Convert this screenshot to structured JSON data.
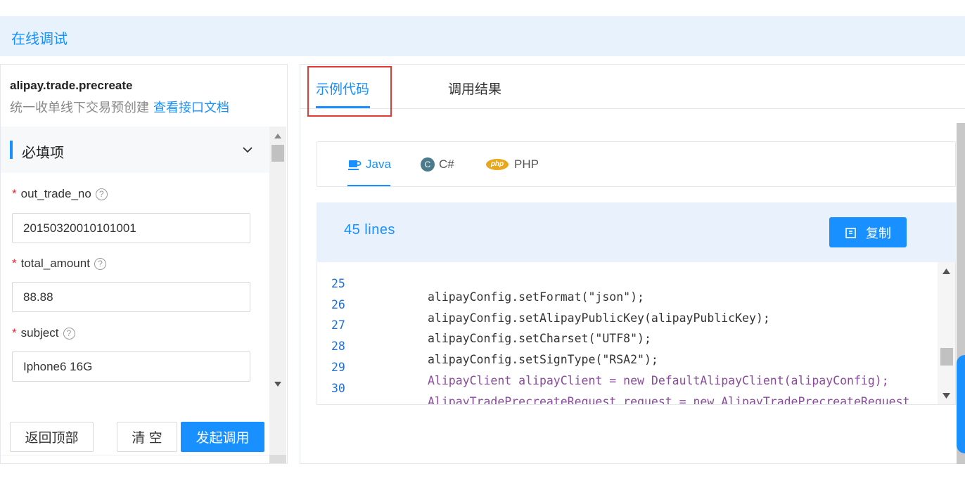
{
  "header": {
    "title": "在线调试"
  },
  "api": {
    "name": "alipay.trade.precreate",
    "description": "统一收单线下交易预创建",
    "doc_link": "查看接口文档"
  },
  "section": {
    "title": "必填项"
  },
  "fields": [
    {
      "name": "out_trade_no",
      "value": "20150320010101001",
      "required": "*",
      "help": "?"
    },
    {
      "name": "total_amount",
      "value": "88.88",
      "required": "*",
      "help": "?"
    },
    {
      "name": "subject",
      "value": "Iphone6 16G",
      "required": "*",
      "help": "?"
    }
  ],
  "buttons": {
    "back_top": "返回顶部",
    "clear": "清 空",
    "invoke": "发起调用"
  },
  "tabs": [
    {
      "label": "示例代码",
      "active": true
    },
    {
      "label": "调用结果",
      "active": false
    }
  ],
  "languages": [
    {
      "label": "Java",
      "active": true
    },
    {
      "label": "C#",
      "active": false,
      "badge": "C"
    },
    {
      "label": "PHP",
      "active": false,
      "badge": "php"
    }
  ],
  "code": {
    "lines_label": "45 lines",
    "copy_label": "复制",
    "lines": [
      {
        "num": "25",
        "text": "alipayConfig.setFormat(\"json\");"
      },
      {
        "num": "26",
        "text": "alipayConfig.setAlipayPublicKey(alipayPublicKey);"
      },
      {
        "num": "27",
        "text": "alipayConfig.setCharset(\"UTF8\");"
      },
      {
        "num": "28",
        "text": "alipayConfig.setSignType(\"RSA2\");"
      },
      {
        "num": "29",
        "text": "AlipayClient alipayClient = new DefaultAlipayClient(alipayConfig);"
      },
      {
        "num": "30",
        "text": "AlipayTradePrecreateRequest request = new AlipayTradePrecreateRequest"
      },
      {
        "num": "",
        "text": "();"
      }
    ]
  },
  "colors": {
    "accent": "#1890ff",
    "required": "#f5222d",
    "highlight_box": "#e53935"
  }
}
